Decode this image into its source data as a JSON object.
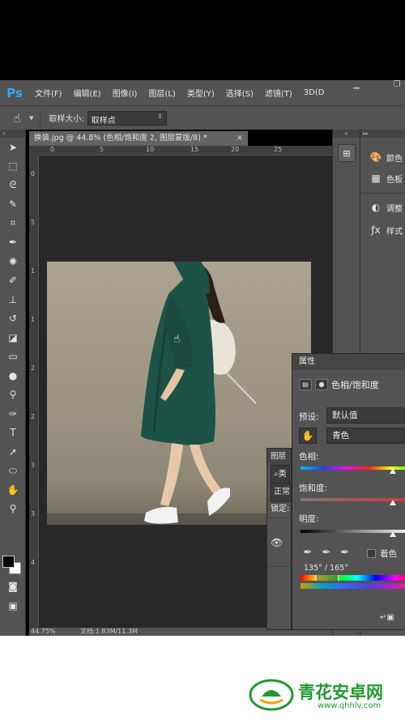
{
  "app": {
    "logo": "Ps",
    "menu": [
      "文件(F)",
      "编辑(E)",
      "图像(I)",
      "图层(L)",
      "类型(Y)",
      "选择(S)",
      "滤镜(T)",
      "3D(D"
    ]
  },
  "options_bar": {
    "sample_size_label": "取样大小:",
    "sample_size_value": "取样点"
  },
  "document": {
    "tab_title": "换装.jpg @ 44.8% (色相/饱和度 2, 图层蒙版/8) *",
    "ruler_h": [
      "0",
      "5",
      "10",
      "15",
      "20",
      "25"
    ],
    "ruler_v": [
      "0",
      "5",
      "1",
      "1",
      "2",
      "2",
      "3",
      "3",
      "4"
    ],
    "status_zoom": "44.75%",
    "status_doc": "文档:1.83M/11.3M"
  },
  "right_dock": {
    "items": [
      {
        "label": "颜色",
        "icon": "palette-icon"
      },
      {
        "label": "色板",
        "icon": "swatches-icon"
      },
      {
        "label": "调整",
        "icon": "adjustments-icon"
      },
      {
        "label": "样式",
        "icon": "styles-icon"
      }
    ]
  },
  "layers_panel": {
    "tab": "图层",
    "search": "类",
    "mode": "正常",
    "lock_label": "锁定:"
  },
  "properties_panel": {
    "tab": "属性",
    "title": "色相/饱和度",
    "preset_label": "预设:",
    "preset_value": "默认值",
    "channel_value": "青色",
    "hue_label": "色相:",
    "saturation_label": "饱和度:",
    "lightness_label": "明度:",
    "colorize_label": "着色",
    "range_text": "135° / 165°"
  },
  "watermark": {
    "title": "青花安卓网",
    "url": "www.qhhlv.com"
  },
  "colors": {
    "panel_bg": "#535353",
    "canvas_bg": "#282828",
    "dress": "#1d5246",
    "ps_blue": "#31a8ff",
    "watermark_green": "#1f9a2f"
  }
}
